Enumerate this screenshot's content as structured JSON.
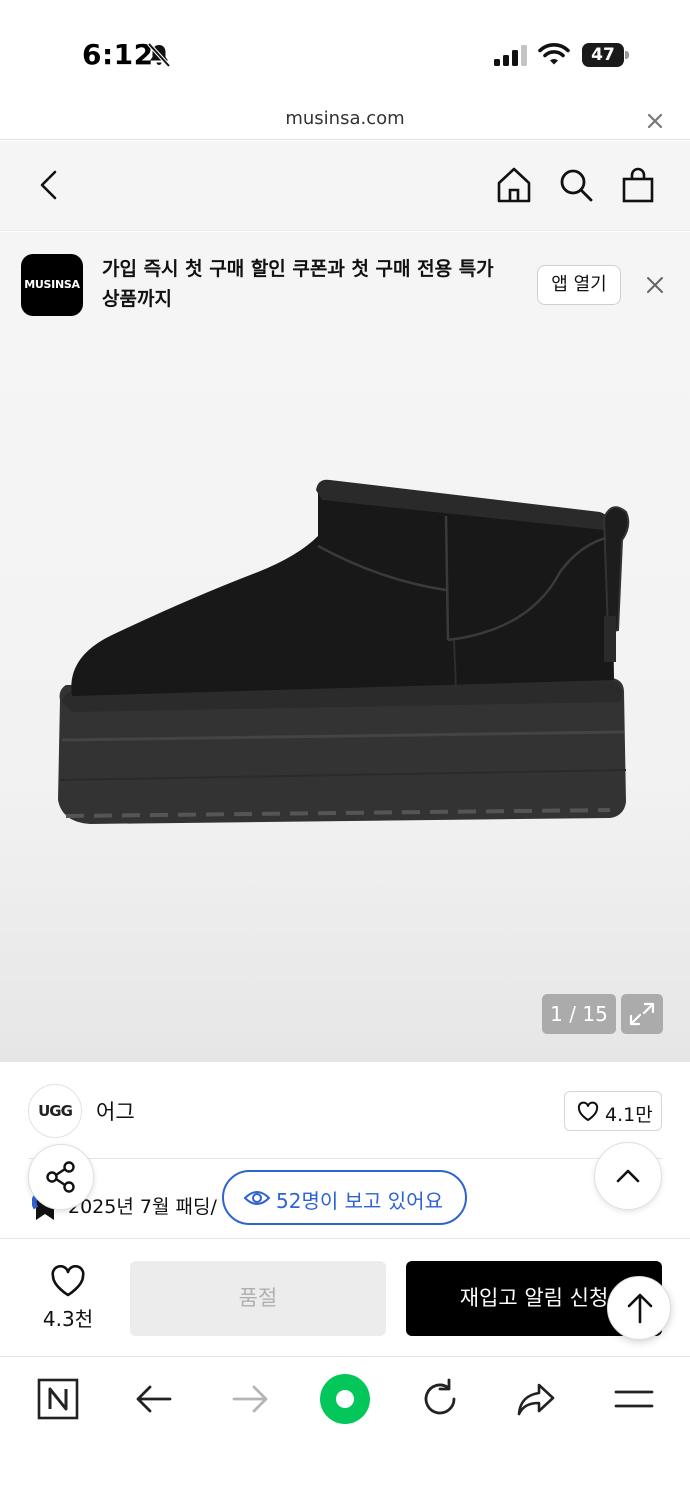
{
  "status_bar": {
    "time": "6:12",
    "battery": "47"
  },
  "url_bar": {
    "domain": "musinsa.com"
  },
  "banner": {
    "logo": "MUSINSA",
    "message": "가입 즉시 첫 구매 할인 쿠폰과 첫 구매 전용 특가 상품까지",
    "app_button": "앱 열기"
  },
  "product": {
    "image_counter": "1 / 15"
  },
  "brand": {
    "logo_text": "UGG",
    "name": "어그",
    "likes": "4.1만"
  },
  "ranking": {
    "text": "2025년 7월 패딩/"
  },
  "viewers": {
    "text": "52명이 보고 있어요"
  },
  "action_bar": {
    "wish_count": "4.3천",
    "soldout_label": "품절",
    "restock_label": "재입고 알림 신청"
  },
  "icons": [
    "bell-slash-icon",
    "signal-icon",
    "wifi-icon",
    "battery-icon",
    "close-icon",
    "back-icon",
    "home-icon",
    "search-icon",
    "shopping-bag-icon",
    "expand-icon",
    "heart-icon",
    "share-icon",
    "chevron-up-icon",
    "eye-icon",
    "arrow-up-icon",
    "naver-n-icon",
    "arrow-left-icon",
    "arrow-right-icon",
    "reload-icon",
    "forward-share-icon",
    "menu-icon"
  ],
  "colors": {
    "accent_blue": "#2e63d6",
    "naver_green": "#03c75a",
    "cta_black": "#000000",
    "soldout_gray": "#ececec"
  }
}
